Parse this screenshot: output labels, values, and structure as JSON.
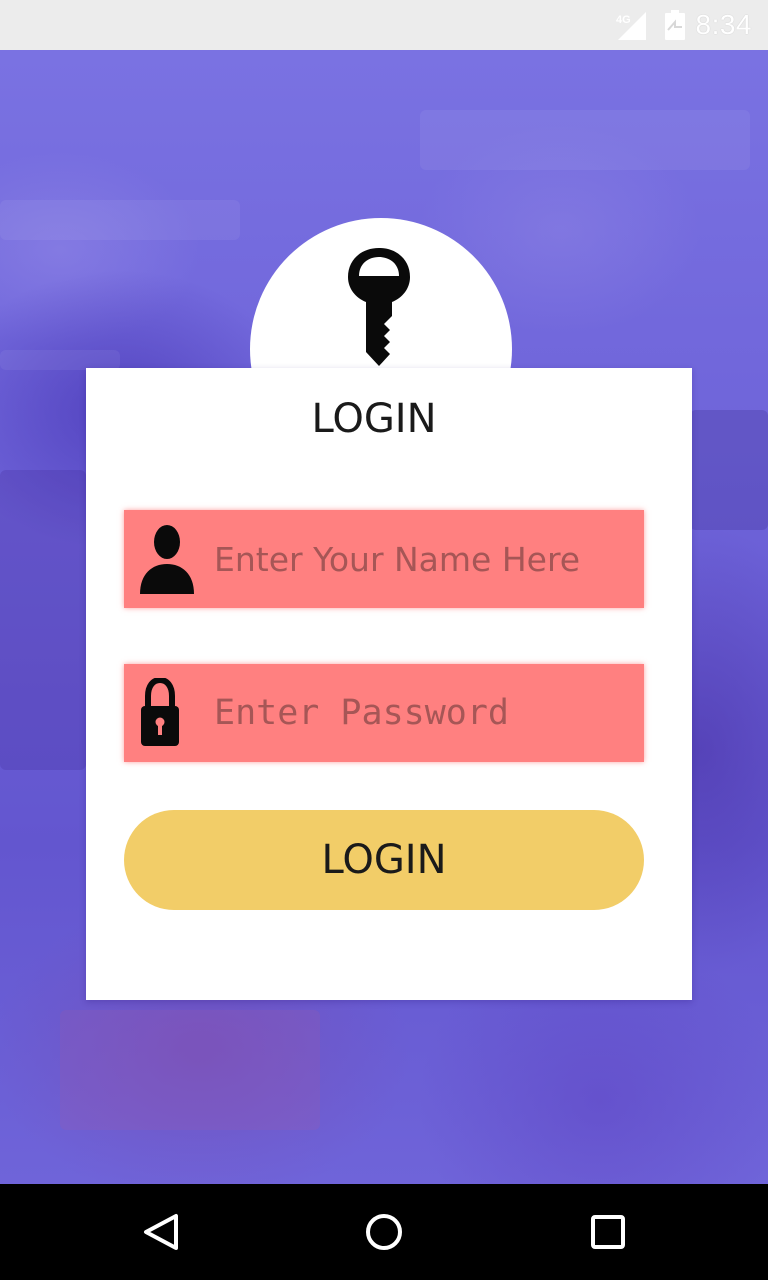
{
  "status_bar": {
    "network": "4G",
    "time": "8:34"
  },
  "login_card": {
    "title": "LOGIN",
    "name_field": {
      "value": "",
      "placeholder": "Enter Your Name Here"
    },
    "password_field": {
      "value": "",
      "placeholder": "Enter Password"
    },
    "login_button": "LOGIN"
  },
  "icons": {
    "key": "key-icon",
    "user": "person-icon",
    "lock": "lock-icon",
    "back": "back-icon",
    "home": "home-icon",
    "recents": "recents-icon",
    "signal": "signal-icon",
    "battery": "battery-icon"
  },
  "colors": {
    "background": "#7066dc",
    "field_fill": "#ff8080",
    "button_fill": "#f2cd68",
    "card": "#ffffff",
    "status_bar": "#ececec"
  }
}
